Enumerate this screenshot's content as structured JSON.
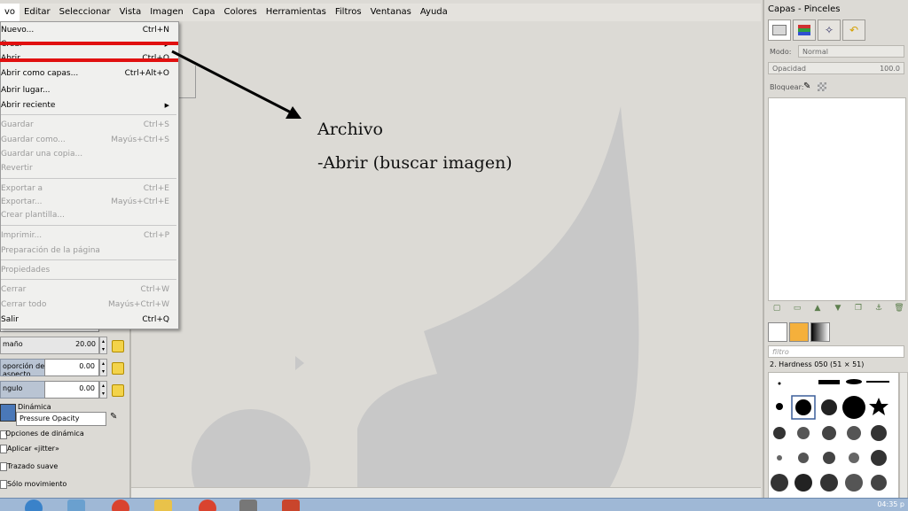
{
  "menubar": {
    "items": [
      "vo",
      "Editar",
      "Seleccionar",
      "Vista",
      "Imagen",
      "Capa",
      "Colores",
      "Herramientas",
      "Filtros",
      "Ventanas",
      "Ayuda"
    ]
  },
  "file_menu": {
    "items": [
      {
        "label": "Nuevo...",
        "shortcut": "Ctrl+N",
        "enabled": true
      },
      {
        "label": "Crear",
        "shortcut": "",
        "enabled": true,
        "submenu": true
      },
      {
        "label": "Abrir...",
        "shortcut": "Ctrl+O",
        "enabled": true
      },
      {
        "label": "Abrir como capas...",
        "shortcut": "Ctrl+Alt+O",
        "enabled": true
      },
      {
        "label": "Abrir lugar...",
        "shortcut": "",
        "enabled": true
      },
      {
        "label": "Abrir reciente",
        "shortcut": "",
        "enabled": true,
        "submenu": true
      },
      {
        "label": "Guardar",
        "shortcut": "Ctrl+S",
        "enabled": false
      },
      {
        "label": "Guardar como...",
        "shortcut": "Mayús+Ctrl+S",
        "enabled": false
      },
      {
        "label": "Guardar una copia...",
        "shortcut": "",
        "enabled": false
      },
      {
        "label": "Revertir",
        "shortcut": "",
        "enabled": false
      },
      {
        "label": "Exportar a",
        "shortcut": "Ctrl+E",
        "enabled": false
      },
      {
        "label": "Exportar...",
        "shortcut": "Mayús+Ctrl+E",
        "enabled": false
      },
      {
        "label": "Crear plantilla...",
        "shortcut": "",
        "enabled": false
      },
      {
        "label": "Imprimir...",
        "shortcut": "Ctrl+P",
        "enabled": false
      },
      {
        "label": "Preparación de la página",
        "shortcut": "",
        "enabled": false
      },
      {
        "label": "Propiedades",
        "shortcut": "",
        "enabled": false
      },
      {
        "label": "Cerrar",
        "shortcut": "Ctrl+W",
        "enabled": false
      },
      {
        "label": "Cerrar todo",
        "shortcut": "Mayús+Ctrl+W",
        "enabled": false
      },
      {
        "label": "Salir",
        "shortcut": "Ctrl+Q",
        "enabled": true
      }
    ]
  },
  "annotation": {
    "line1": "Archivo",
    "line2": "-Abrir (buscar imagen)"
  },
  "tool_options": {
    "size_label": "maño",
    "size_value": "20.00",
    "aspect_label": "oporción de aspecto",
    "aspect_value": "0.00",
    "angle_label": "ngulo",
    "angle_value": "0.00",
    "dynamics_label": "Dinámica",
    "dynamics_value": "Pressure Opacity",
    "dynamics_options": "Opciones de dinámica",
    "jitter": "Aplicar «jitter»",
    "smooth": "Trazado suave",
    "motion_only": "Sólo movimiento"
  },
  "dock": {
    "title": "Capas - Pinceles",
    "mode_label": "Modo:",
    "mode_value": "Normal",
    "opacity_label": "Opacidad",
    "opacity_value": "100.0",
    "lock_label": "Bloquear:",
    "filter_placeholder": "filtro",
    "brush_name": "2. Hardness 050 (51 × 51)"
  },
  "taskbar": {
    "clock": "04:35 p"
  },
  "colors": {
    "highlight_red": "#e11010",
    "fg_color": "#000000",
    "bg_color": "#f5b03b"
  },
  "icons": [
    "gimp-wilber-icon",
    "layers-icon",
    "channels-icon",
    "paths-icon",
    "undo-history-icon",
    "brush-icon",
    "lock-icon",
    "new-layer-icon",
    "raise-layer-icon",
    "lower-layer-icon",
    "duplicate-layer-icon",
    "anchor-icon",
    "delete-layer-icon"
  ]
}
